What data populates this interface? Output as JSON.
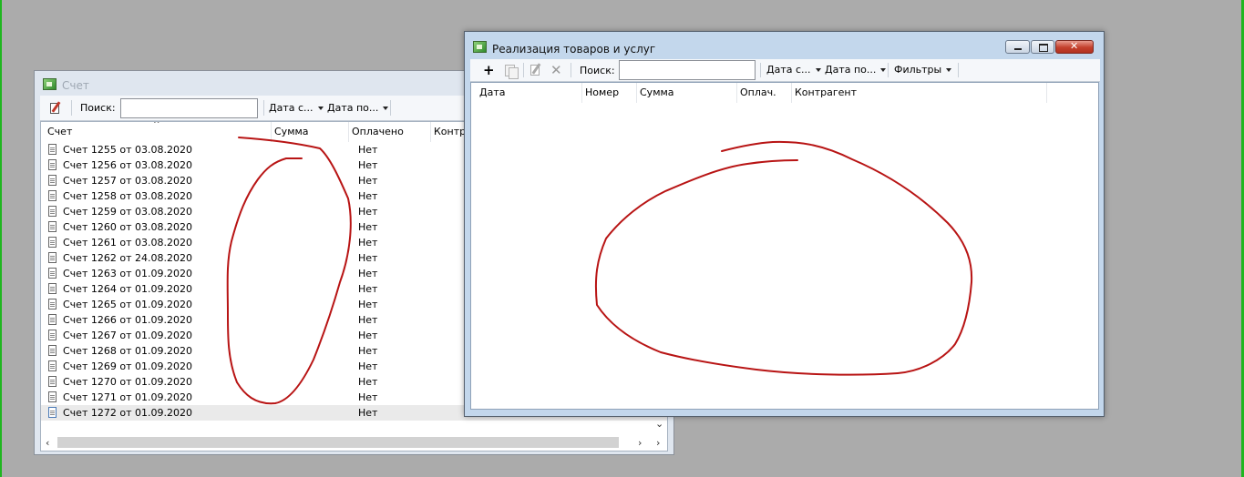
{
  "annotation_color": "#b81414",
  "window_schet": {
    "title": "Счет",
    "toolbar": {
      "search_label": "Поиск:",
      "search_value": "",
      "date_from": "Дата с...",
      "date_to": "Дата по..."
    },
    "columns": [
      "Счет",
      "Сумма",
      "Оплачено",
      "Контр"
    ],
    "rows": [
      {
        "name": "Счет 1255 от 03.08.2020",
        "sum": "",
        "paid": "Нет"
      },
      {
        "name": "Счет 1256 от 03.08.2020",
        "sum": "",
        "paid": "Нет"
      },
      {
        "name": "Счет 1257 от 03.08.2020",
        "sum": "",
        "paid": "Нет"
      },
      {
        "name": "Счет 1258 от 03.08.2020",
        "sum": "",
        "paid": "Нет"
      },
      {
        "name": "Счет 1259 от 03.08.2020",
        "sum": "",
        "paid": "Нет"
      },
      {
        "name": "Счет 1260 от 03.08.2020",
        "sum": "",
        "paid": "Нет"
      },
      {
        "name": "Счет 1261 от 03.08.2020",
        "sum": "",
        "paid": "Нет"
      },
      {
        "name": "Счет 1262 от 24.08.2020",
        "sum": "",
        "paid": "Нет"
      },
      {
        "name": "Счет 1263 от 01.09.2020",
        "sum": "",
        "paid": "Нет"
      },
      {
        "name": "Счет 1264 от 01.09.2020",
        "sum": "",
        "paid": "Нет"
      },
      {
        "name": "Счет 1265 от 01.09.2020",
        "sum": "",
        "paid": "Нет"
      },
      {
        "name": "Счет 1266 от 01.09.2020",
        "sum": "",
        "paid": "Нет"
      },
      {
        "name": "Счет 1267 от 01.09.2020",
        "sum": "",
        "paid": "Нет"
      },
      {
        "name": "Счет 1268 от 01.09.2020",
        "sum": "",
        "paid": "Нет"
      },
      {
        "name": "Счет 1269 от 01.09.2020",
        "sum": "",
        "paid": "Нет"
      },
      {
        "name": "Счет 1270 от 01.09.2020",
        "sum": "",
        "paid": "Нет"
      },
      {
        "name": "Счет 1271 от 01.09.2020",
        "sum": "",
        "paid": "Нет"
      },
      {
        "name": "Счет 1272 от 01.09.2020",
        "sum": "",
        "paid": "Нет",
        "selected": true
      }
    ]
  },
  "window_realizaciya": {
    "title": "Реализация товаров и услуг",
    "toolbar": {
      "add": "+",
      "search_label": "Поиск:",
      "search_value": "",
      "date_from": "Дата с...",
      "date_to": "Дата по...",
      "filters": "Фильтры"
    },
    "columns": [
      "Дата",
      "Номер",
      "Сумма",
      "Оплач.",
      "Контрагент"
    ],
    "rows": []
  }
}
